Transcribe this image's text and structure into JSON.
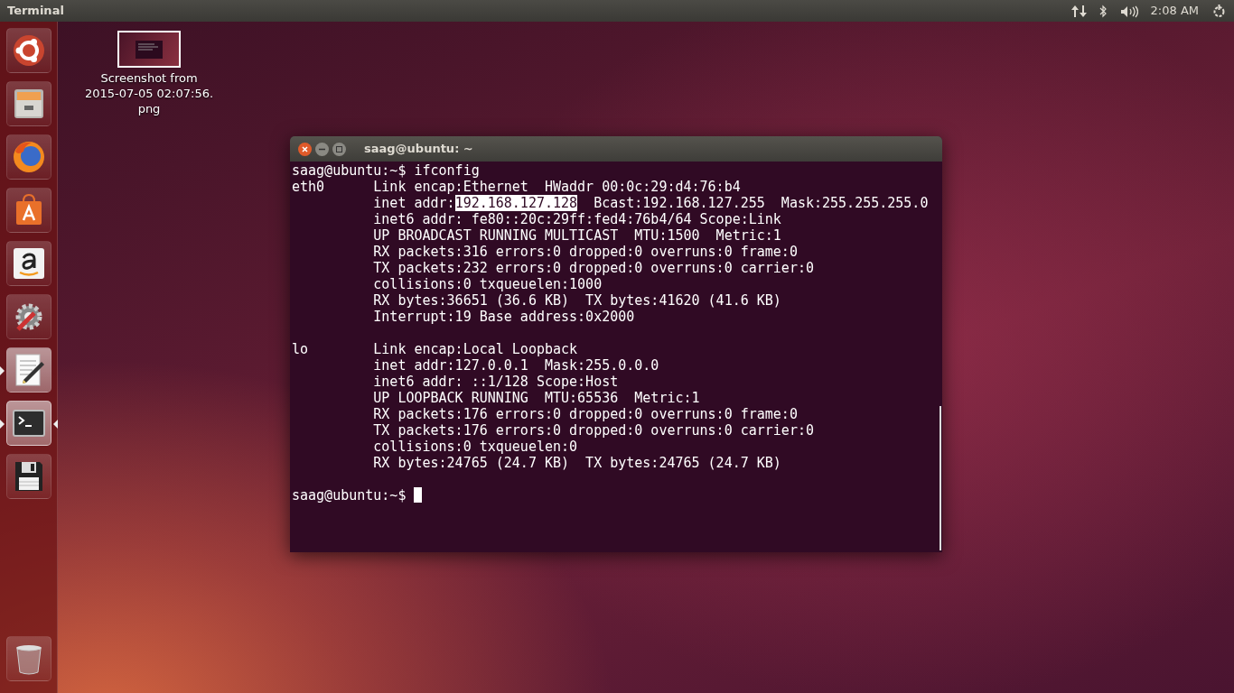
{
  "top_bar": {
    "title": "Terminal",
    "clock": "2:08 AM"
  },
  "launcher": [
    {
      "kind": "dash",
      "running": false,
      "focused": false
    },
    {
      "kind": "files",
      "running": false,
      "focused": false
    },
    {
      "kind": "browser",
      "running": false,
      "focused": false
    },
    {
      "kind": "store",
      "running": false,
      "focused": false
    },
    {
      "kind": "amazon",
      "running": false,
      "focused": false
    },
    {
      "kind": "settings",
      "running": false,
      "focused": false
    },
    {
      "kind": "editor",
      "running": true,
      "focused": false
    },
    {
      "kind": "terminal",
      "running": true,
      "focused": true
    },
    {
      "kind": "disk",
      "running": false,
      "focused": false
    }
  ],
  "trash": {
    "kind": "trash"
  },
  "desktop_icons": [
    {
      "label_lines": [
        "Screenshot from",
        "2015-07-05 02:07:56.",
        "png"
      ]
    }
  ],
  "terminal": {
    "title": "saag@ubuntu: ~",
    "blocks": [
      {
        "lines": [
          {
            "text": "saag@ubuntu:~$ ifconfig"
          },
          {
            "text": "eth0      Link encap:Ethernet  HWaddr 00:0c:29:d4:76:b4"
          },
          {
            "text": "          inet addr:",
            "selection": "192.168.127.128",
            "after": "  Bcast:192.168.127.255  Mask:255.255.255.0"
          },
          {
            "text": "          inet6 addr: fe80::20c:29ff:fed4:76b4/64 Scope:Link"
          },
          {
            "text": "          UP BROADCAST RUNNING MULTICAST  MTU:1500  Metric:1"
          },
          {
            "text": "          RX packets:316 errors:0 dropped:0 overruns:0 frame:0"
          },
          {
            "text": "          TX packets:232 errors:0 dropped:0 overruns:0 carrier:0"
          },
          {
            "text": "          collisions:0 txqueuelen:1000"
          },
          {
            "text": "          RX bytes:36651 (36.6 KB)  TX bytes:41620 (41.6 KB)"
          },
          {
            "text": "          Interrupt:19 Base address:0x2000"
          }
        ]
      },
      {
        "lines": [
          {
            "text": "lo        Link encap:Local Loopback"
          },
          {
            "text": "          inet addr:127.0.0.1  Mask:255.0.0.0"
          },
          {
            "text": "          inet6 addr: ::1/128 Scope:Host"
          },
          {
            "text": "          UP LOOPBACK RUNNING  MTU:65536  Metric:1"
          },
          {
            "text": "          RX packets:176 errors:0 dropped:0 overruns:0 frame:0"
          },
          {
            "text": "          TX packets:176 errors:0 dropped:0 overruns:0 carrier:0"
          },
          {
            "text": "          collisions:0 txqueuelen:0"
          },
          {
            "text": "          RX bytes:24765 (24.7 KB)  TX bytes:24765 (24.7 KB)"
          }
        ]
      }
    ],
    "prompt": "saag@ubuntu:~$ "
  }
}
